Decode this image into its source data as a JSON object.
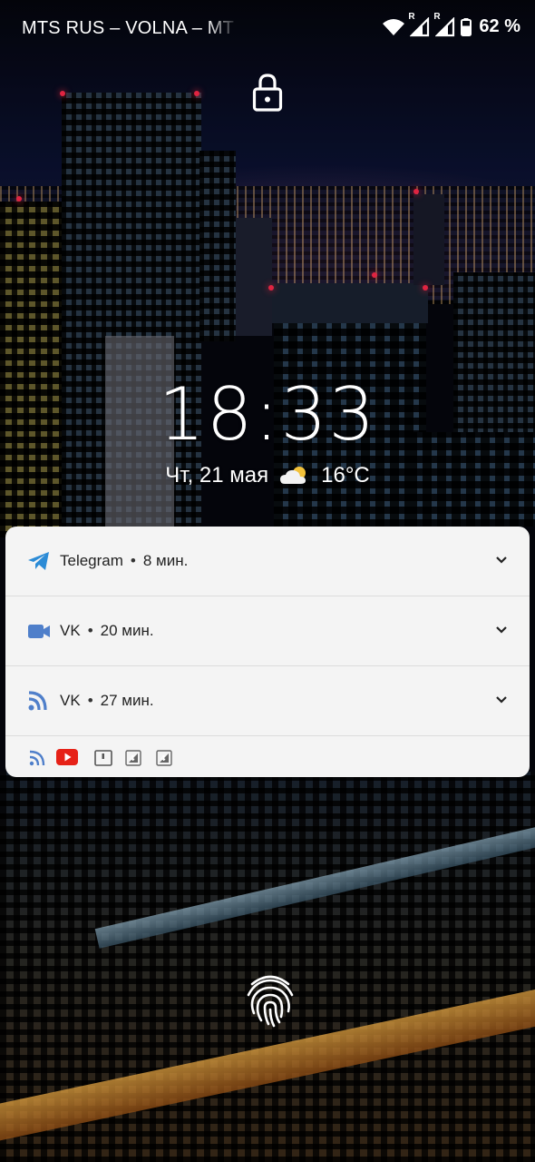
{
  "status_bar": {
    "carrier": "MTS RUS – VOLNA – MT",
    "battery_percent": "62 %",
    "wifi_icon": "wifi-icon",
    "signal_1": {
      "icon": "signal-icon",
      "roaming_label": "R"
    },
    "signal_2": {
      "icon": "signal-icon",
      "roaming_label": "R"
    },
    "battery_icon": "battery-icon"
  },
  "lock_icon": "lock-icon",
  "clock": {
    "time": "18:33",
    "date": "Чт, 21 мая",
    "weather_icon": "partly-cloudy-icon",
    "temperature": "16°C"
  },
  "notifications": [
    {
      "app": "Telegram",
      "time": "8 мин.",
      "icon": "telegram-icon",
      "icon_color": "#2b8bd6"
    },
    {
      "app": "VK",
      "time": "20 мин.",
      "icon": "video-icon",
      "icon_color": "#4f7fca"
    },
    {
      "app": "VK",
      "time": "27 мин.",
      "icon": "rss-icon",
      "icon_color": "#4f7fca"
    }
  ],
  "separator": "•",
  "mini_icons": [
    "rss-icon",
    "youtube-icon",
    "sim-icon",
    "signal-4-icon",
    "signal-4-icon"
  ],
  "fingerprint_icon": "fingerprint-icon",
  "colors": {
    "panel_bg": "#f4f4f4",
    "youtube_red": "#e62117"
  }
}
